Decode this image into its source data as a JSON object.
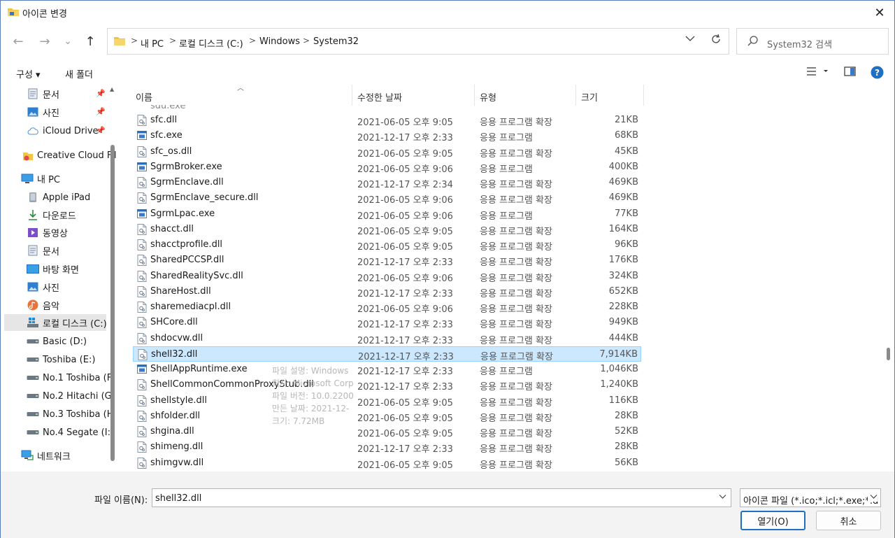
{
  "window": {
    "title": "아이콘 변경",
    "close_glyph": "✕"
  },
  "navigation": {
    "back_glyph": "←",
    "forward_glyph": "→",
    "recent_glyph": "⌄",
    "up_glyph": "↑"
  },
  "address_bar": {
    "crumbs": [
      "내 PC",
      "로컬 디스크 (C:)",
      "Windows",
      "System32"
    ],
    "separator": ">"
  },
  "search": {
    "placeholder": "System32 검색"
  },
  "toolbar": {
    "organize_label": "구성 ▾",
    "new_folder_label": "새 폴더",
    "help_glyph": "?"
  },
  "sidebar": {
    "items": [
      {
        "label": "문서",
        "icon": "document-icon",
        "pinned": true
      },
      {
        "label": "사진",
        "icon": "pictures-icon",
        "pinned": true
      },
      {
        "label": "iCloud Drive",
        "icon": "cloud-icon",
        "pinned": true
      },
      {
        "label": "Creative Cloud Fil",
        "icon": "creative-cloud-icon",
        "pinned": false
      },
      {
        "label": "내 PC",
        "icon": "pc-icon",
        "pinned": false
      },
      {
        "label": "Apple iPad",
        "icon": "ipad-icon",
        "pinned": false
      },
      {
        "label": "다운로드",
        "icon": "download-icon",
        "pinned": false
      },
      {
        "label": "동영상",
        "icon": "video-icon",
        "pinned": false
      },
      {
        "label": "문서",
        "icon": "document-icon",
        "pinned": false
      },
      {
        "label": "바탕 화면",
        "icon": "desktop-icon",
        "pinned": false
      },
      {
        "label": "사진",
        "icon": "pictures-icon",
        "pinned": false
      },
      {
        "label": "음악",
        "icon": "music-icon",
        "pinned": false
      },
      {
        "label": "로컬 디스크 (C:)",
        "icon": "windows-drive-icon",
        "pinned": false
      },
      {
        "label": "Basic (D:)",
        "icon": "drive-icon",
        "pinned": false
      },
      {
        "label": "Toshiba (E:)",
        "icon": "drive-icon",
        "pinned": false
      },
      {
        "label": "No.1 Toshiba (F",
        "icon": "drive-icon",
        "pinned": false
      },
      {
        "label": "No.2 Hitachi (G:",
        "icon": "drive-icon",
        "pinned": false
      },
      {
        "label": "No.3 Toshiba (H",
        "icon": "drive-icon",
        "pinned": false
      },
      {
        "label": "No.4 Segate (I:)",
        "icon": "drive-icon",
        "pinned": false
      },
      {
        "label": "네트워크",
        "icon": "network-icon",
        "pinned": false
      }
    ]
  },
  "file_list": {
    "columns": {
      "name": "이름",
      "date": "수정한 날짜",
      "type": "유형",
      "size": "크기"
    },
    "partial_top_row": "sdu.exe",
    "rows": [
      {
        "name": "sfc.dll",
        "date": "2021-06-05 오후 9:05",
        "type": "응용 프로그램 확장",
        "size": "21KB",
        "kind": "dll"
      },
      {
        "name": "sfc.exe",
        "date": "2021-12-17 오후 2:33",
        "type": "응용 프로그램",
        "size": "68KB",
        "kind": "exe"
      },
      {
        "name": "sfc_os.dll",
        "date": "2021-06-05 오후 9:05",
        "type": "응용 프로그램 확장",
        "size": "45KB",
        "kind": "dll"
      },
      {
        "name": "SgrmBroker.exe",
        "date": "2021-06-05 오후 9:06",
        "type": "응용 프로그램",
        "size": "400KB",
        "kind": "exe"
      },
      {
        "name": "SgrmEnclave.dll",
        "date": "2021-12-17 오후 2:34",
        "type": "응용 프로그램 확장",
        "size": "469KB",
        "kind": "dll"
      },
      {
        "name": "SgrmEnclave_secure.dll",
        "date": "2021-06-05 오후 9:06",
        "type": "응용 프로그램 확장",
        "size": "469KB",
        "kind": "dll"
      },
      {
        "name": "SgrmLpac.exe",
        "date": "2021-06-05 오후 9:06",
        "type": "응용 프로그램",
        "size": "77KB",
        "kind": "exe"
      },
      {
        "name": "shacct.dll",
        "date": "2021-06-05 오후 9:05",
        "type": "응용 프로그램 확장",
        "size": "164KB",
        "kind": "dll"
      },
      {
        "name": "shacctprofile.dll",
        "date": "2021-06-05 오후 9:05",
        "type": "응용 프로그램 확장",
        "size": "96KB",
        "kind": "dll"
      },
      {
        "name": "SharedPCCSP.dll",
        "date": "2021-12-17 오후 2:33",
        "type": "응용 프로그램 확장",
        "size": "176KB",
        "kind": "dll"
      },
      {
        "name": "SharedRealitySvc.dll",
        "date": "2021-06-05 오후 9:06",
        "type": "응용 프로그램 확장",
        "size": "324KB",
        "kind": "dll"
      },
      {
        "name": "ShareHost.dll",
        "date": "2021-12-17 오후 2:33",
        "type": "응용 프로그램 확장",
        "size": "652KB",
        "kind": "dll"
      },
      {
        "name": "sharemediacpl.dll",
        "date": "2021-06-05 오후 9:06",
        "type": "응용 프로그램 확장",
        "size": "228KB",
        "kind": "dll"
      },
      {
        "name": "SHCore.dll",
        "date": "2021-12-17 오후 2:33",
        "type": "응용 프로그램 확장",
        "size": "949KB",
        "kind": "dll"
      },
      {
        "name": "shdocvw.dll",
        "date": "2021-12-17 오후 2:33",
        "type": "응용 프로그램 확장",
        "size": "444KB",
        "kind": "dll"
      },
      {
        "name": "shell32.dll",
        "date": "2021-12-17 오후 2:33",
        "type": "응용 프로그램 확장",
        "size": "7,914KB",
        "kind": "dll",
        "selected": true
      },
      {
        "name": "ShellAppRuntime.exe",
        "date": "2021-12-17 오후 2:33",
        "type": "응용 프로그램",
        "size": "1,046KB",
        "kind": "exe"
      },
      {
        "name": "ShellCommonCommonProxyStub.dll",
        "date": "2021-12-17 오후 2:33",
        "type": "응용 프로그램 확장",
        "size": "1,240KB",
        "kind": "dll"
      },
      {
        "name": "shellstyle.dll",
        "date": "2021-06-05 오후 9:05",
        "type": "응용 프로그램 확장",
        "size": "116KB",
        "kind": "dll"
      },
      {
        "name": "shfolder.dll",
        "date": "2021-06-05 오후 9:05",
        "type": "응용 프로그램 확장",
        "size": "28KB",
        "kind": "dll"
      },
      {
        "name": "shgina.dll",
        "date": "2021-06-05 오후 9:05",
        "type": "응용 프로그램 확장",
        "size": "52KB",
        "kind": "dll"
      },
      {
        "name": "shimeng.dll",
        "date": "2021-12-17 오후 2:33",
        "type": "응용 프로그램 확장",
        "size": "28KB",
        "kind": "dll"
      },
      {
        "name": "shimgvw.dll",
        "date": "2021-06-05 오후 9:05",
        "type": "응용 프로그램 확장",
        "size": "56KB",
        "kind": "dll"
      }
    ]
  },
  "tooltip": {
    "lines": [
      "파일 설명: Windows",
      "회사: Microsoft Corp",
      "파일 버전: 10.0.2200",
      "만든 날짜: 2021-12-",
      "크기: 7.72MB"
    ]
  },
  "footer": {
    "filename_label": "파일 이름(N):",
    "filename_value": "shell32.dll",
    "filetype_value": "아이콘 파일 (*.ico;*.icl;*.exe;*.d",
    "open_label": "열기(O)",
    "cancel_label": "취소"
  },
  "colors": {
    "selection_bg": "#cce8ff",
    "selection_border": "#99d1ff",
    "accent": "#1f6fc5",
    "folder": "#f3c544"
  }
}
